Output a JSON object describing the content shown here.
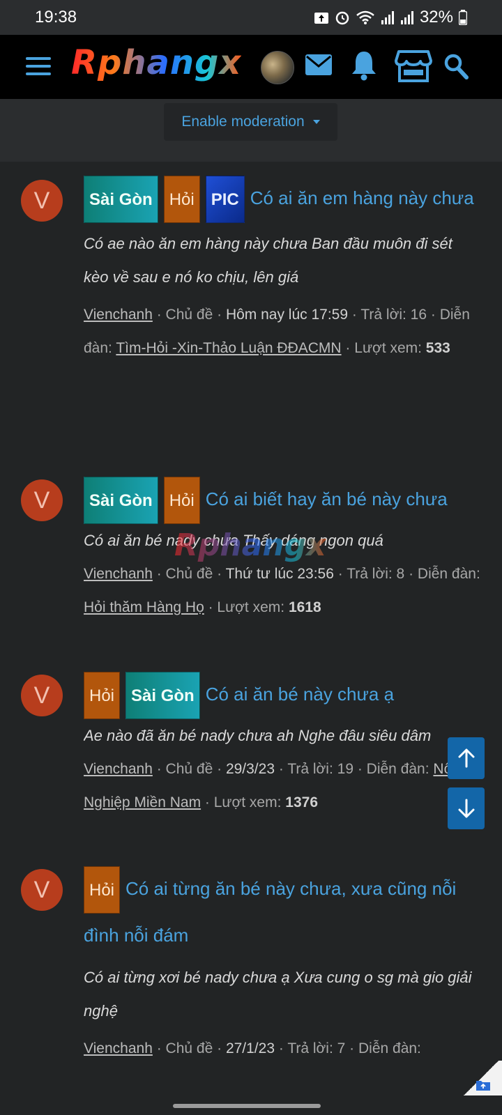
{
  "status": {
    "time": "19:38",
    "battery": "32%"
  },
  "header": {
    "logo_text": "Rphangx",
    "icons": [
      "menu-icon",
      "avatar",
      "mail-icon",
      "bell-icon",
      "store-icon",
      "search-icon"
    ]
  },
  "moderation": {
    "label": "Enable moderation"
  },
  "threads": [
    {
      "avatar_letter": "V",
      "tags": [
        "Sài Gòn",
        "Hỏi",
        "PIC"
      ],
      "title": "Có ai ăn em hàng này chưa",
      "snippet": "Có ae nào ăn em hàng này chưa Ban đầu muôn đi sét kèo về sau e nó ko chịu, lên giá",
      "author": "Vienchanh",
      "type": "Chủ đề",
      "date": "Hôm nay lúc 17:59",
      "replies_label": "Trả lời: 16",
      "forum_label": "Diễn đàn:",
      "forum": "Tìm-Hỏi -Xin-Thảo Luận ĐĐACMN",
      "views_label": "Lượt xem:",
      "views": "533"
    },
    {
      "avatar_letter": "V",
      "tags": [
        "Sài Gòn",
        "Hỏi"
      ],
      "title": "Có ai biết hay ăn bé này chưa",
      "snippet": "Có ai ăn bé nady chưa Thấy dáng ngon quá",
      "author": "Vienchanh",
      "type": "Chủ đề",
      "date": "Thứ tư lúc 23:56",
      "replies_label": "Trả lời: 8",
      "forum_label": "Diễn đàn:",
      "forum": "Hỏi thăm Hàng Họ",
      "views_label": "Lượt xem:",
      "views": "1618"
    },
    {
      "avatar_letter": "V",
      "tags": [
        "Hỏi",
        "Sài Gòn"
      ],
      "title": "Có ai ăn bé này chưa ạ",
      "snippet": "Ae nào đã ăn bé nady chưa ah Nghe đâu siêu dâm",
      "author": "Vienchanh",
      "type": "Chủ đề",
      "date": "29/3/23",
      "replies_label": "Trả lời: 19",
      "forum_label": "Diễn đàn:",
      "forum": "Nông Nghiệp Miền Nam",
      "views_label": "Lượt xem:",
      "views": "1376"
    },
    {
      "avatar_letter": "V",
      "tags": [
        "Hỏi"
      ],
      "title": "Có ai từng ăn bé này chưa, xưa cũng nỗi đình nỗi đám",
      "snippet": "Có ai từng xơi bé nady chưa ạ Xưa cung o sg mà gio giải nghệ",
      "author": "Vienchanh",
      "type": "Chủ đề",
      "date": "27/1/23",
      "replies_label": "Trả lời: 7",
      "forum_label": "Diễn đàn:"
    }
  ],
  "watermark": "Rphangx",
  "colors": {
    "accent": "#4aa3df",
    "header_bg": "#000000",
    "avatar": "#b73d1d",
    "tag_hoi": "#b2560c",
    "tag_sg": "#1aa3b3",
    "tag_pic": "#1f4fd6",
    "fab": "#1366a8"
  }
}
